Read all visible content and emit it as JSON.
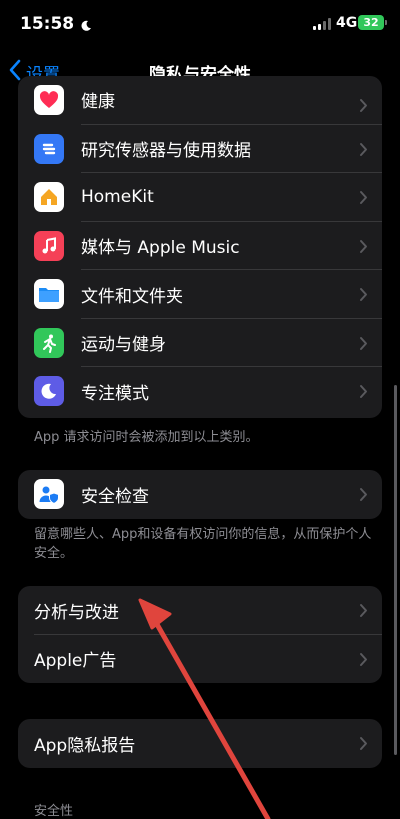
{
  "status_bar": {
    "time": "15:58",
    "network": "4G",
    "battery": "32"
  },
  "nav": {
    "back_label": "设置",
    "title": "隐私与安全性"
  },
  "app_rows": [
    {
      "label": "健康",
      "icon": "heart-icon",
      "color": "#ffffff"
    },
    {
      "label": "研究传感器与使用数据",
      "icon": "research-icon",
      "color": "#3478f6"
    },
    {
      "label": "HomeKit",
      "icon": "home-icon",
      "color": "#ffffff"
    },
    {
      "label": "媒体与 Apple Music",
      "icon": "music-note-icon",
      "color": "#f54057"
    },
    {
      "label": "文件和文件夹",
      "icon": "folder-icon",
      "color": "#ffffff"
    },
    {
      "label": "运动与健身",
      "icon": "fitness-icon",
      "color": "#31c75a"
    },
    {
      "label": "专注模式",
      "icon": "moon-icon",
      "color": "#5e5ce6"
    }
  ],
  "apps_footnote": "App 请求访问时会被添加到以上类别。",
  "safety_check": {
    "label": "安全检查",
    "icon": "safety-check-icon"
  },
  "safety_footnote": "留意哪些人、App和设备有权访问你的信息，从而保护个人安全。",
  "analytics_rows": [
    {
      "label": "分析与改进"
    },
    {
      "label": "Apple广告"
    }
  ],
  "privacy_report": {
    "label": "App隐私报告"
  },
  "security_header": "安全性",
  "annotation": {
    "color": "#e0453d"
  }
}
